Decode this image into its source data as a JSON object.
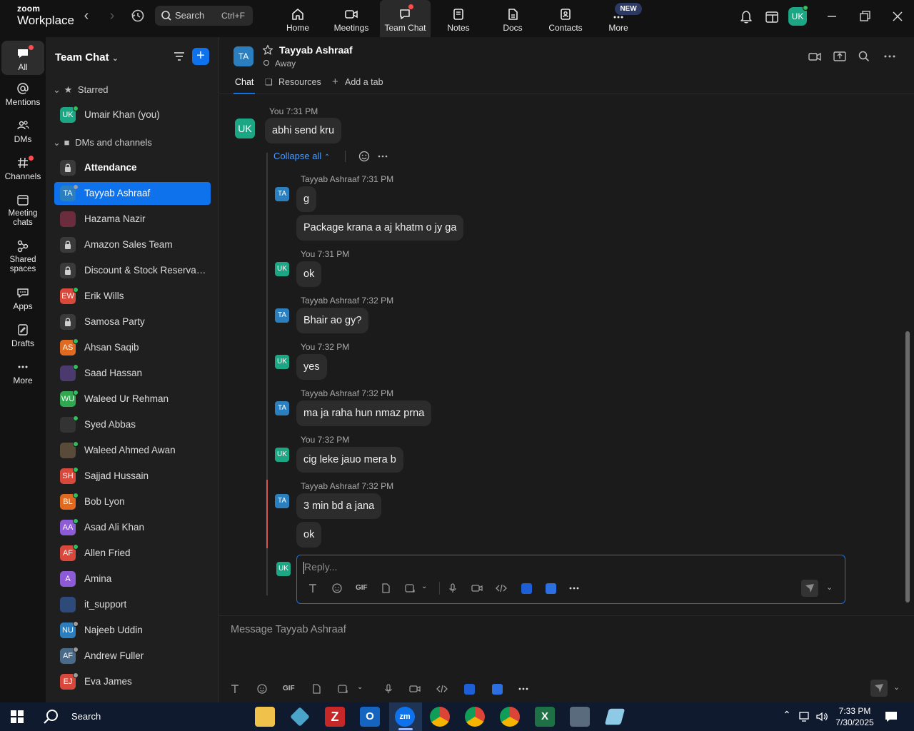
{
  "app": {
    "logo_top": "zoom",
    "logo_bottom": "Workplace"
  },
  "topbar": {
    "search_label": "Search",
    "search_shortcut": "Ctrl+F",
    "tabs": [
      {
        "label": "Home",
        "icon": "home-icon"
      },
      {
        "label": "Meetings",
        "icon": "video-camera-icon"
      },
      {
        "label": "Team Chat",
        "icon": "chat-bubble-icon"
      },
      {
        "label": "Notes",
        "icon": "notes-icon"
      },
      {
        "label": "Docs",
        "icon": "docs-icon"
      },
      {
        "label": "Contacts",
        "icon": "contacts-icon"
      },
      {
        "label": "More",
        "icon": "more-icon"
      }
    ],
    "new_badge": "NEW",
    "user_initials": "UK"
  },
  "rail": {
    "items": [
      {
        "label": "All",
        "icon": "chat-icon"
      },
      {
        "label": "Mentions",
        "icon": "at-sign-icon"
      },
      {
        "label": "DMs",
        "icon": "people-icon"
      },
      {
        "label": "Channels",
        "icon": "hash-icon"
      },
      {
        "label": "Meeting chats",
        "icon": "calendar-icon"
      },
      {
        "label": "Shared spaces",
        "icon": "shared-icon"
      },
      {
        "label": "Apps",
        "icon": "apps-icon"
      },
      {
        "label": "Drafts",
        "icon": "drafts-icon"
      },
      {
        "label": "More",
        "icon": "ellipsis-icon"
      }
    ]
  },
  "sidebar": {
    "title": "Team Chat",
    "starred_label": "Starred",
    "starred_item": "Umair Khan (you)",
    "dms_label": "DMs and channels",
    "items": [
      {
        "name": "Attendance",
        "initials": "",
        "color": "#3a3a3a",
        "bold": true,
        "lock": true
      },
      {
        "name": "Tayyab Ashraaf",
        "initials": "TA",
        "color": "#2c7fbf",
        "active": true
      },
      {
        "name": "Hazama Nazir",
        "initials": "",
        "color": "#6b2d3d"
      },
      {
        "name": "Amazon Sales Team",
        "initials": "",
        "color": "#3a3a3a",
        "lock": true
      },
      {
        "name": "Discount & Stock Reservati...",
        "initials": "",
        "color": "#3a3a3a",
        "lock": true
      },
      {
        "name": "Erik Wills",
        "initials": "EW",
        "color": "#d9483b"
      },
      {
        "name": "Samosa Party",
        "initials": "",
        "color": "#3a3a3a",
        "lock": true
      },
      {
        "name": "Ahsan Saqib",
        "initials": "AS",
        "color": "#e06a1f"
      },
      {
        "name": "Saad Hassan",
        "initials": "",
        "color": "#4b3a6e"
      },
      {
        "name": "Waleed Ur Rehman",
        "initials": "WU",
        "color": "#2fa84f"
      },
      {
        "name": "Syed Abbas",
        "initials": "",
        "color": "#333"
      },
      {
        "name": "Waleed Ahmed Awan",
        "initials": "",
        "color": "#5a4a3a"
      },
      {
        "name": "Sajjad Hussain",
        "initials": "SH",
        "color": "#d9483b"
      },
      {
        "name": "Bob Lyon",
        "initials": "BL",
        "color": "#e06a1f"
      },
      {
        "name": "Asad Ali Khan",
        "initials": "AA",
        "color": "#8e5bd6"
      },
      {
        "name": "Allen Fried",
        "initials": "AF",
        "color": "#d9483b"
      },
      {
        "name": "Amina",
        "initials": "A",
        "color": "#8e5bd6"
      },
      {
        "name": "it_support",
        "initials": "",
        "color": "#2d4a7a"
      },
      {
        "name": "Najeeb Uddin",
        "initials": "NU",
        "color": "#2c7fbf"
      },
      {
        "name": "Andrew Fuller",
        "initials": "AF",
        "color": "#4a6a8a"
      },
      {
        "name": "Eva James",
        "initials": "EJ",
        "color": "#d9483b"
      }
    ]
  },
  "chat": {
    "header_initials": "TA",
    "name": "Tayyab Ashraaf",
    "status": "Away",
    "tabs": [
      "Chat",
      "Resources",
      "Add a tab"
    ],
    "root": {
      "meta": "You 7:31 PM",
      "text": "abhi send kru",
      "initials": "UK"
    },
    "collapse_label": "Collapse all",
    "replies": [
      {
        "meta": "Tayyab Ashraaf 7:31 PM",
        "initials": "TA",
        "lines": [
          "g",
          "Package krana a aj khatm o jy ga"
        ]
      },
      {
        "meta": "You 7:31 PM",
        "initials": "UK",
        "lines": [
          "ok"
        ]
      },
      {
        "meta": "Tayyab Ashraaf 7:32 PM",
        "initials": "TA",
        "lines": [
          "Bhair ao gy?"
        ]
      },
      {
        "meta": "You 7:32 PM",
        "initials": "UK",
        "lines": [
          "yes"
        ]
      },
      {
        "meta": "Tayyab Ashraaf 7:32 PM",
        "initials": "TA",
        "lines": [
          "ma ja raha hun nmaz prna"
        ]
      },
      {
        "meta": "You 7:32 PM",
        "initials": "UK",
        "lines": [
          "cig leke jauo mera b"
        ]
      },
      {
        "meta": "Tayyab Ashraaf 7:32 PM",
        "initials": "TA",
        "lines": [
          "3 min bd a jana",
          "ok"
        ]
      }
    ],
    "reply_initials": "UK",
    "reply_placeholder": "Reply...",
    "composer_placeholder": "Message Tayyab Ashraaf",
    "gif_label": "GIF"
  },
  "taskbar": {
    "search_label": "Search",
    "time": "7:33 PM",
    "date": "7/30/2025"
  },
  "colors": {
    "accent": "#0e72ed",
    "online": "#2fbf5b",
    "uk_avatar": "#1ba784",
    "ta_avatar": "#2c7fbf"
  }
}
